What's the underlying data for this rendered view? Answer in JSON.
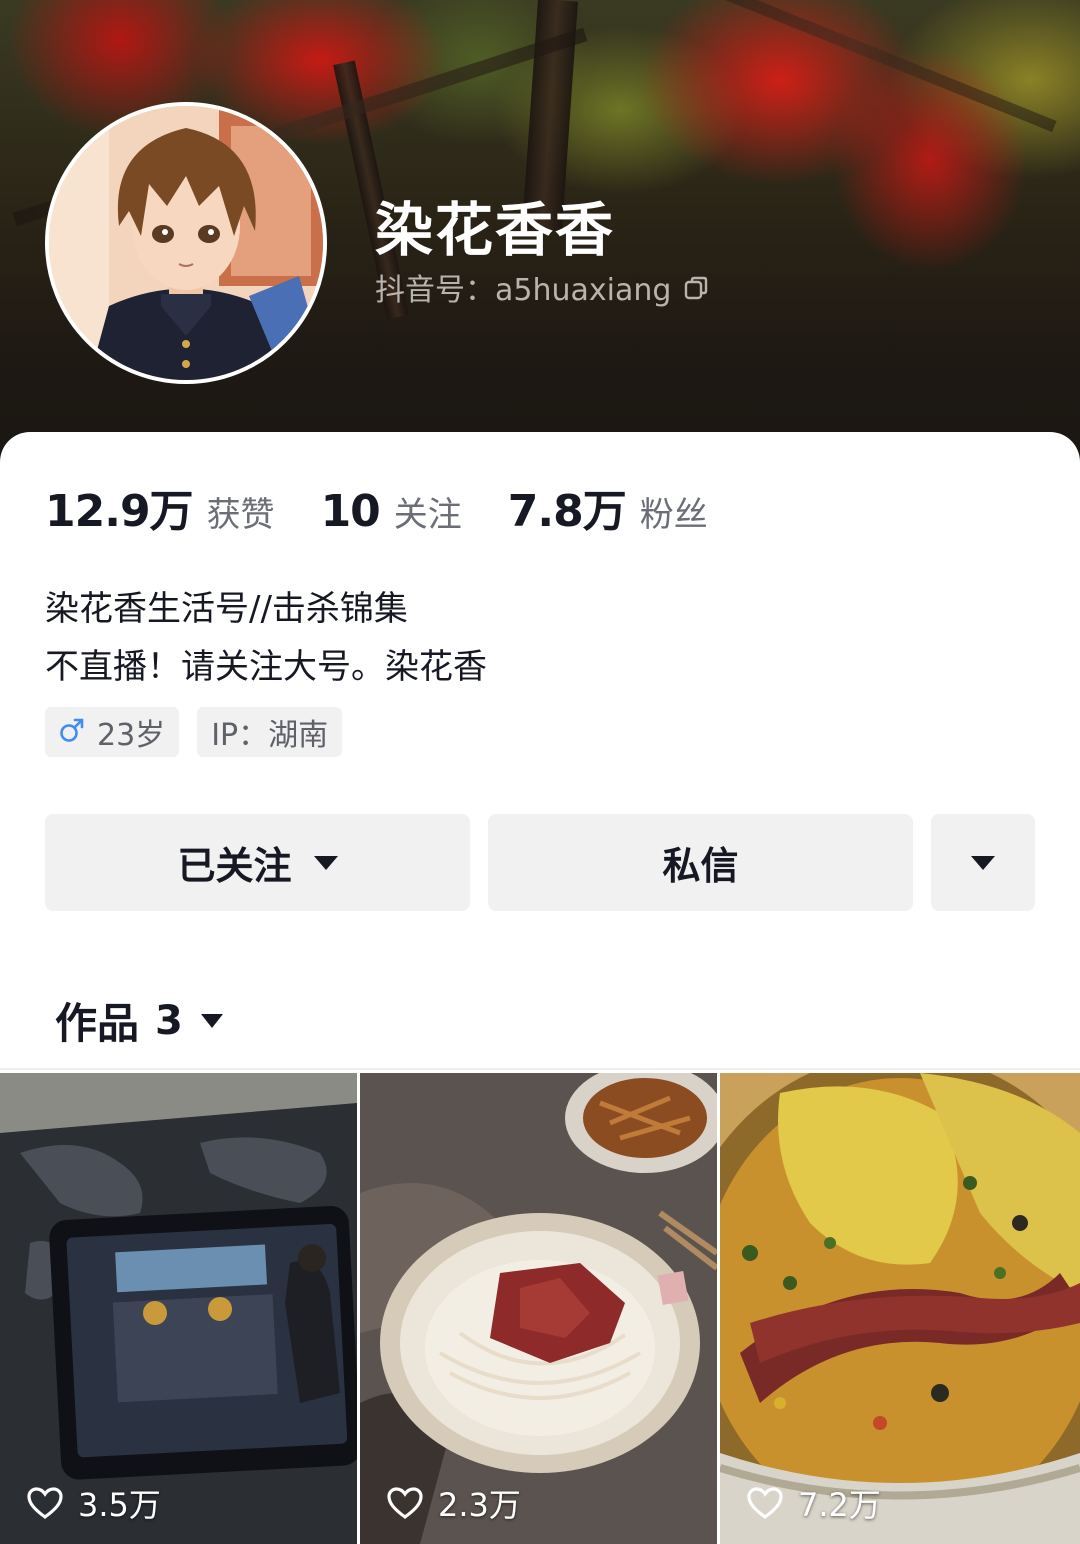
{
  "profile": {
    "nickname": "染花香香",
    "douyin_id": "抖音号：a5huaxiang"
  },
  "stats": [
    {
      "value": "12.9万",
      "label": "获赞"
    },
    {
      "value": "10",
      "label": "关注"
    },
    {
      "value": "7.8万",
      "label": "粉丝"
    }
  ],
  "bio": {
    "line1": "染花香生活号//击杀锦集",
    "line2": "不直播！请关注大号。染花香"
  },
  "tags": {
    "age": "23岁",
    "ip": "IP：湖南"
  },
  "actions": {
    "following_label": "已关注",
    "message_label": "私信"
  },
  "works": {
    "label": "作品",
    "count": "3"
  },
  "videos": [
    {
      "likes": "3.5万"
    },
    {
      "likes": "2.3万"
    },
    {
      "likes": "7.2万"
    }
  ],
  "colors": {
    "gender_male": "#3f8cf5",
    "button_bg": "#f1f1f2",
    "text_primary": "#161823"
  }
}
